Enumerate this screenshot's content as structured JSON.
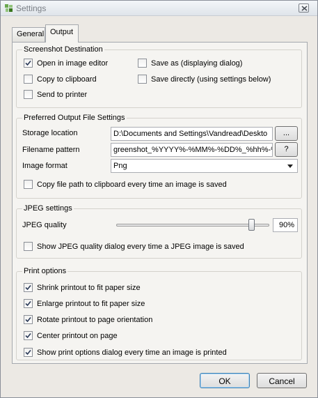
{
  "window": {
    "title": "Settings"
  },
  "tabs": {
    "general": "General",
    "output": "Output"
  },
  "destination": {
    "title": "Screenshot Destination",
    "open_editor": {
      "label": "Open in image editor",
      "checked": true
    },
    "copy_clipboard": {
      "label": "Copy to clipboard",
      "checked": false
    },
    "send_printer": {
      "label": "Send to printer",
      "checked": false
    },
    "save_as": {
      "label": "Save as (displaying dialog)",
      "checked": false
    },
    "save_directly": {
      "label": "Save directly (using settings below)",
      "checked": false
    }
  },
  "output_settings": {
    "title": "Preferred Output File Settings",
    "storage_label": "Storage location",
    "storage_value": "D:\\Documents and Settings\\Vandread\\Deskto",
    "browse_label": "...",
    "pattern_label": "Filename pattern",
    "pattern_value": "greenshot_%YYYY%-%MM%-%DD%_%hh%-%m",
    "help_label": "?",
    "format_label": "Image format",
    "format_value": "Png",
    "copy_path": {
      "label": "Copy file path to clipboard every time an image is saved",
      "checked": false
    }
  },
  "jpeg": {
    "title": "JPEG settings",
    "quality_label": "JPEG quality",
    "quality_value": "90%",
    "quality_level": 0.9,
    "show_dialog": {
      "label": "Show JPEG quality dialog every time a JPEG image is saved",
      "checked": false
    }
  },
  "print": {
    "title": "Print options",
    "shrink": {
      "label": "Shrink printout to fit paper size",
      "checked": true
    },
    "enlarge": {
      "label": "Enlarge printout to fit paper size",
      "checked": true
    },
    "rotate": {
      "label": "Rotate printout to page orientation",
      "checked": true
    },
    "center": {
      "label": "Center printout on page",
      "checked": true
    },
    "show_dialog": {
      "label": "Show print options dialog every time an image is printed",
      "checked": true
    }
  },
  "buttons": {
    "ok": "OK",
    "cancel": "Cancel"
  }
}
